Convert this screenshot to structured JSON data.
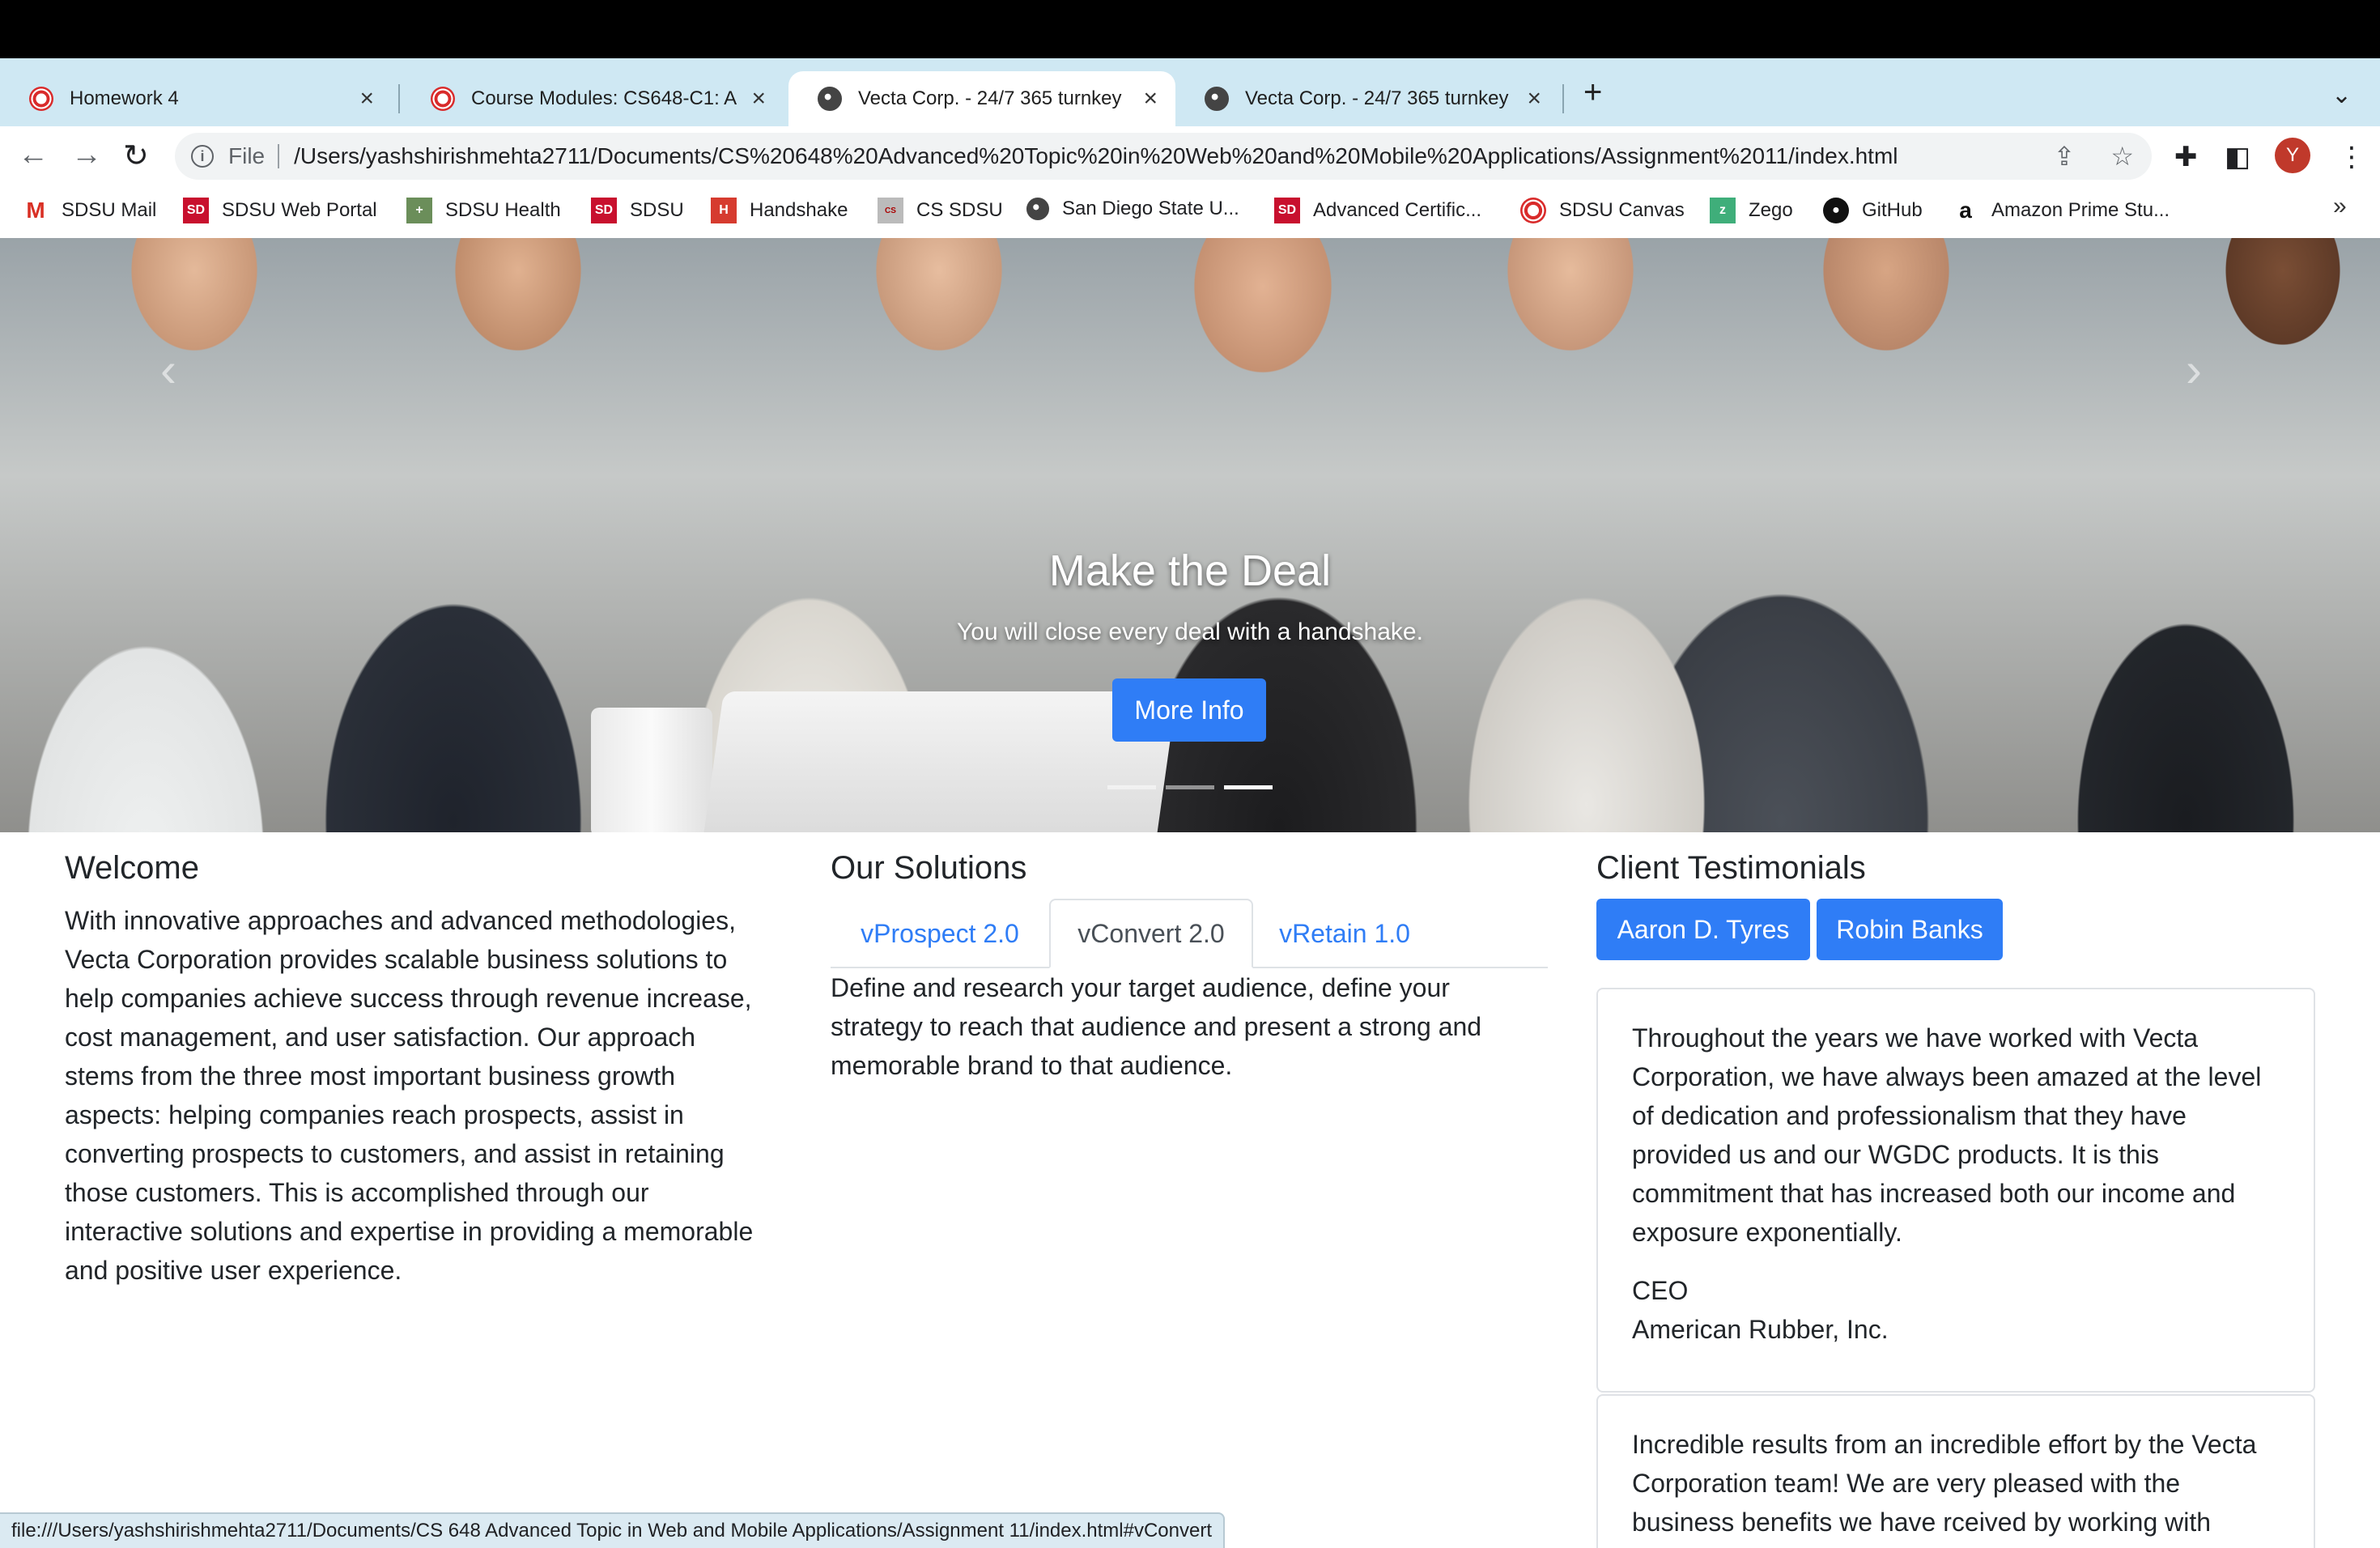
{
  "browser": {
    "tabs": [
      {
        "title": "Homework 4",
        "icon": "canvas-icon"
      },
      {
        "title": "Course Modules: CS648-C1: A",
        "icon": "canvas-icon"
      },
      {
        "title": "Vecta Corp. - 24/7 365 turnkey",
        "icon": "globe-icon"
      },
      {
        "title": "Vecta Corp. - 24/7 365 turnkey",
        "icon": "globe-icon"
      }
    ],
    "active_tab": 2,
    "address": {
      "scheme_label": "File",
      "url": "/Users/yashshirishmehta2711/Documents/CS%20648%20Advanced%20Topic%20in%20Web%20and%20Mobile%20Applications/Assignment%2011/index.html"
    },
    "profile_initial": "Y",
    "bookmarks": [
      {
        "label": "SDSU Mail",
        "icon": "gmail-icon"
      },
      {
        "label": "SDSU Web Portal",
        "icon": "sd-icon"
      },
      {
        "label": "SDSU Health",
        "icon": "health-icon"
      },
      {
        "label": "SDSU",
        "icon": "sd-icon"
      },
      {
        "label": "Handshake",
        "icon": "handshake-icon"
      },
      {
        "label": "CS SDSU",
        "icon": "cs-icon"
      },
      {
        "label": "San Diego State U...",
        "icon": "globe-icon"
      },
      {
        "label": "Advanced Certific...",
        "icon": "sd-icon"
      },
      {
        "label": "SDSU Canvas",
        "icon": "canvas-icon"
      },
      {
        "label": "Zego",
        "icon": "zego-icon"
      },
      {
        "label": "GitHub",
        "icon": "github-icon"
      },
      {
        "label": "Amazon Prime Stu...",
        "icon": "amazon-icon"
      }
    ],
    "bookmarks_overflow": "»",
    "status_url": "file:///Users/yashshirishmehta2711/Documents/CS 648 Advanced Topic in Web and Mobile Applications/Assignment 11/index.html#vConvert"
  },
  "carousel": {
    "title": "Make the Deal",
    "text": "You will close every deal with a handshake.",
    "button": "More Info",
    "slides": 3,
    "active_slide": 2
  },
  "welcome": {
    "heading": "Welcome",
    "lines": [
      "With innovative approaches and advanced methodologies,",
      "Vecta Corporation provides scalable business solutions to",
      "help companies achieve success through revenue increase,",
      "cost management, and user satisfaction. Our approach",
      "stems from the three most important business growth",
      "aspects: helping companies reach prospects, assist in",
      "converting prospects to customers, and assist in retaining",
      "those customers. This is accomplished through our",
      "interactive solutions and expertise in providing a memorable",
      "and positive user experience."
    ]
  },
  "solutions": {
    "heading": "Our Solutions",
    "tabs": [
      "vProspect 2.0",
      "vConvert 2.0",
      "vRetain 1.0"
    ],
    "active_tab": 1,
    "lines": [
      "Define and research your target audience, define your",
      "strategy to reach that audience and present a strong and",
      "memorable brand to that audience."
    ]
  },
  "testimonials": {
    "heading": "Client Testimonials",
    "buttons": [
      "Aaron D. Tyres",
      "Robin Banks"
    ],
    "cards": [
      {
        "lines": [
          "Throughout the years we have worked with Vecta",
          "Corporation, we have always been amazed at the level",
          "of dedication and professionalism that they have",
          "provided us and our WGDC products. It is this",
          "commitment that has increased both our income and",
          "exposure exponentially."
        ],
        "role": "CEO",
        "company": "American Rubber, Inc."
      },
      {
        "lines": [
          "Incredible results from an incredible effort by the Vecta",
          "Corporation team! We are very pleased with the",
          "business benefits we have rceived by working with"
        ]
      }
    ]
  }
}
